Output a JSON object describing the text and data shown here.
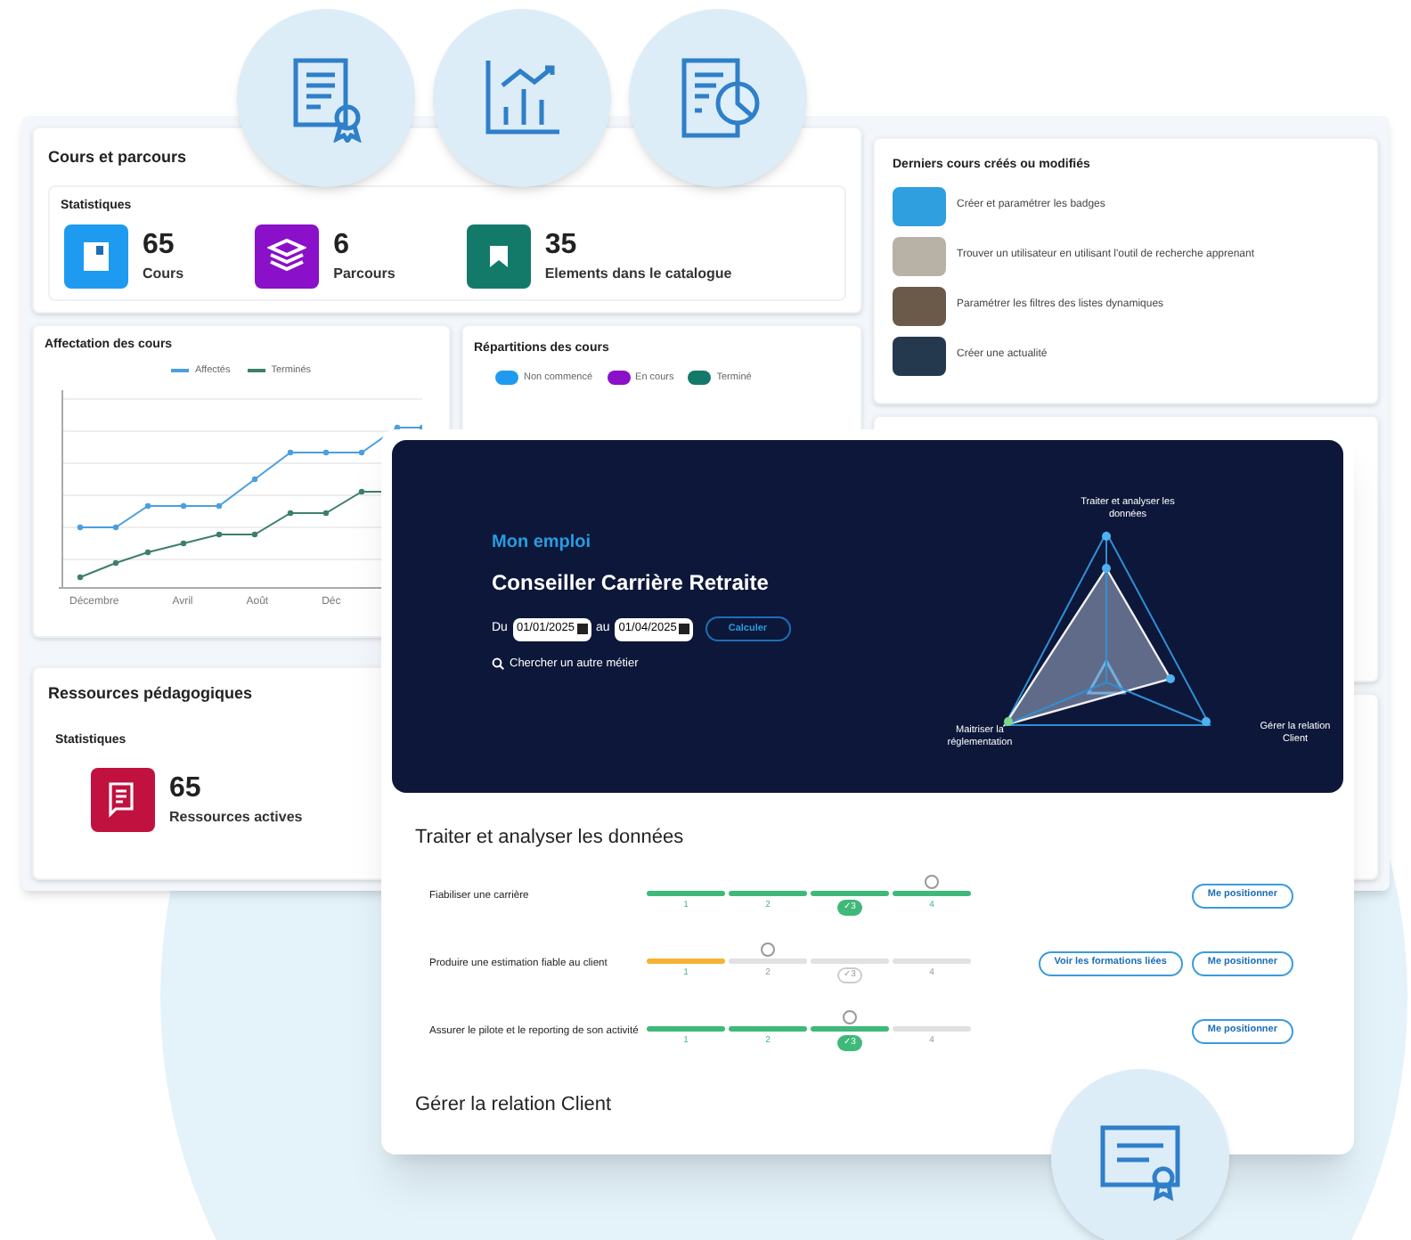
{
  "courses_section": {
    "title": "Cours et parcours",
    "stats_title": "Statistiques",
    "stats": [
      {
        "value": "65",
        "label": "Cours",
        "color": "#1e9bf0"
      },
      {
        "value": "6",
        "label": "Parcours",
        "color": "#8a10c9"
      },
      {
        "value": "35",
        "label": "Elements dans le catalogue",
        "color": "#137a6a"
      }
    ]
  },
  "assignment_chart": {
    "title": "Affectation des cours",
    "legend": [
      {
        "label": "Affectés",
        "color": "#4a9fe0"
      },
      {
        "label": "Terminés",
        "color": "#3e7f6c"
      }
    ],
    "x_labels": [
      "Décembre",
      "Avril",
      "Août",
      "Déc"
    ]
  },
  "distribution": {
    "title": "Répartitions des cours",
    "legend": [
      {
        "label": "Non commencé",
        "color": "#1e9bf0"
      },
      {
        "label": "En cours",
        "color": "#8a10c9"
      },
      {
        "label": "Terminé",
        "color": "#137a6a"
      }
    ]
  },
  "recent_courses": {
    "title": "Derniers cours créés ou modifiés",
    "items": [
      "Créer et paramétrer les badges",
      "Trouver un utilisateur en utilisant l'outil de recherche apprenant",
      "Paramétrer les filtres des listes dynamiques",
      "Créer une actualité"
    ]
  },
  "resources_section": {
    "title": "Ressources pédagogiques",
    "stats_title": "Statistiques",
    "stats": [
      {
        "value": "65",
        "label": "Ressources actives",
        "color": "#c0113f"
      }
    ]
  },
  "job_panel": {
    "kicker": "Mon emploi",
    "title": "Conseiller Carrière Retraite",
    "from_label": "Du",
    "from_date": "01/01/2025",
    "to_label": "au",
    "to_date": "01/04/2025",
    "calc_button": "Calculer",
    "search_link": "Chercher un autre métier",
    "radar_axes": [
      "Traiter et analyser les données",
      "Maitriser la réglementation",
      "Gérer la relation Client"
    ]
  },
  "skill_group": {
    "title": "Traiter et analyser les données",
    "check_mark": "✓",
    "rows": [
      {
        "label": "Fiabiliser une carrière",
        "color": "#3fb97a",
        "segments": [
          {
            "label": "1",
            "filled": true,
            "marker": false,
            "target": false
          },
          {
            "label": "2",
            "filled": true,
            "marker": false,
            "target": false
          },
          {
            "label": "3",
            "filled": true,
            "marker": false,
            "target": true
          },
          {
            "label": "4",
            "filled": true,
            "marker": true,
            "target": false
          }
        ],
        "buttons": [
          "Me positionner"
        ]
      },
      {
        "label": "Produire une estimation fiable au client",
        "color": "#f5b335",
        "segments": [
          {
            "label": "1",
            "filled": true,
            "marker": false,
            "target": false
          },
          {
            "label": "2",
            "filled": false,
            "marker": true,
            "target": false
          },
          {
            "label": "3",
            "filled": false,
            "marker": false,
            "target": true
          },
          {
            "label": "4",
            "filled": false,
            "marker": false,
            "target": false
          }
        ],
        "buttons": [
          "Voir les formations liées",
          "Me positionner"
        ]
      },
      {
        "label": "Assurer le pilote et le reporting de son activité",
        "color": "#3fb97a",
        "segments": [
          {
            "label": "1",
            "filled": true,
            "marker": false,
            "target": false
          },
          {
            "label": "2",
            "filled": true,
            "marker": false,
            "target": false
          },
          {
            "label": "3",
            "filled": true,
            "marker": true,
            "target": true
          },
          {
            "label": "4",
            "filled": false,
            "marker": false,
            "target": false
          }
        ],
        "buttons": [
          "Me positionner"
        ]
      }
    ]
  },
  "next_group": {
    "title": "Gérer la relation Client"
  }
}
